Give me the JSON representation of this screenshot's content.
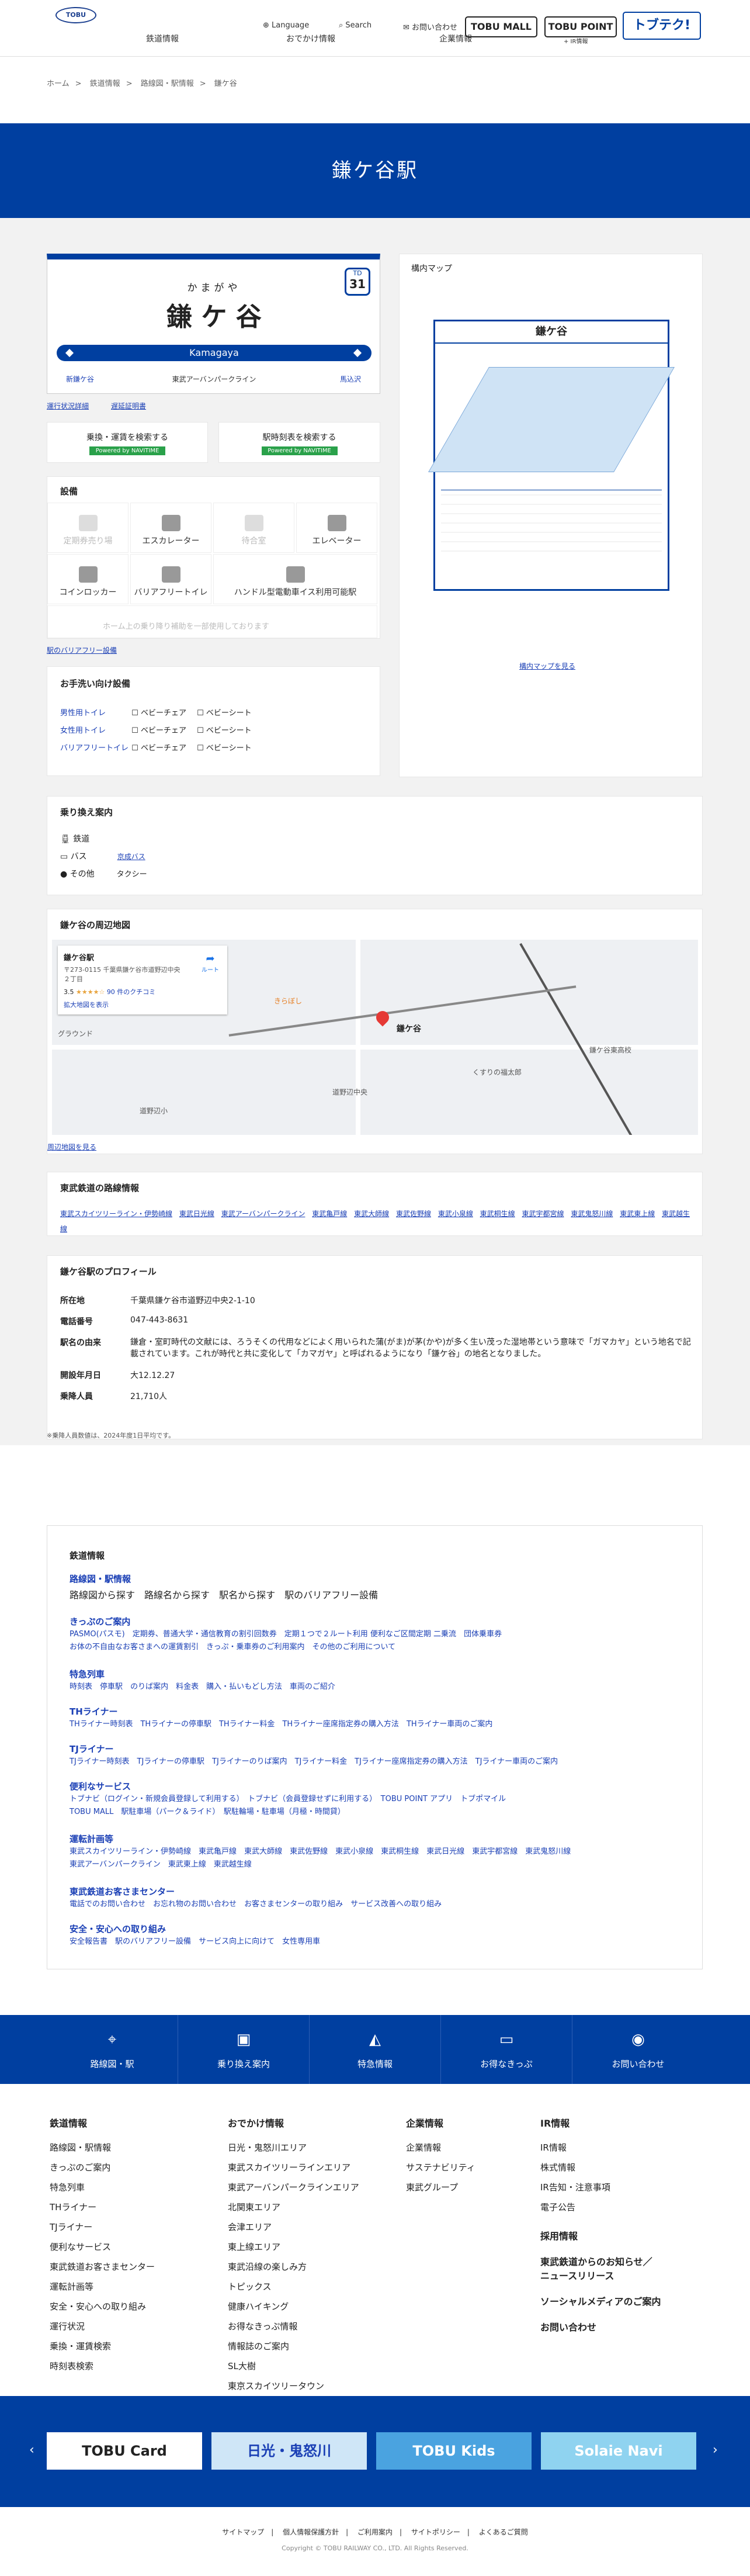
{
  "header": {
    "logo": "TOBU",
    "nav": [
      "鉄道情報",
      "おでかけ情報",
      "企業情報"
    ],
    "language": "Language",
    "search": "Search",
    "contact": "お問い合わせ",
    "btn_mall": "TOBU MALL",
    "btn_point": "TOBU POINT",
    "btn_point_sub": "+ IR情報",
    "btn_tobuteku": "トブテク!"
  },
  "breadcrumb": [
    "ホーム",
    "鉄道情報",
    "路線図・駅情報",
    "鎌ケ谷"
  ],
  "hero_title": "鎌ケ谷駅",
  "sign": {
    "kana": "かまがや",
    "name": "鎌 ケ 谷",
    "roman": "Kamagaya",
    "code_top": "TD",
    "code_num": "31",
    "prev": "新鎌ケ谷",
    "line": "東武アーバンパークライン",
    "next": "馬込沢"
  },
  "sign_links": [
    "運行状況詳細",
    "遅延証明書"
  ],
  "search_boxes": [
    {
      "label": "乗換・運賃を検索する",
      "powered": "Powered by NAVITIME"
    },
    {
      "label": "駅時刻表を検索する",
      "powered": "Powered by NAVITIME"
    }
  ],
  "facilities": {
    "title": "設備",
    "items": [
      "定期券売り場",
      "エスカレーター",
      "待合室",
      "エレベーター",
      "コインロッカー",
      "バリアフリートイレ",
      "ハンドル型電動車イス利用可能駅",
      "ホーム上の乗り降り補助を一部使用しております"
    ],
    "link": "駅のバリアフリー設備"
  },
  "toilets": {
    "title": "お手洗い向け設備",
    "rows": [
      {
        "name": "男性用トイレ",
        "items": [
          "ベビーチェア",
          "ベビーシート"
        ]
      },
      {
        "name": "女性用トイレ",
        "items": [
          "ベビーチェア",
          "ベビーシート"
        ]
      },
      {
        "name": "バリアフリートイレ",
        "items": [
          "ベビーチェア",
          "ベビーシート"
        ]
      }
    ]
  },
  "map": {
    "title": "構内マップ",
    "station": "鎌ケ谷",
    "link": "構内マップを見る"
  },
  "transfer": {
    "title": "乗り換え案内",
    "rows": [
      {
        "k": "鉄道",
        "v": ""
      },
      {
        "k": "バス",
        "v": "京成バス"
      },
      {
        "k": "その他",
        "v": "タクシー"
      }
    ]
  },
  "area_map": {
    "title": "鎌ケ谷の周辺地図",
    "place": "鎌ケ谷駅",
    "address": "〒273-0115 千葉県鎌ケ谷市道野辺中央２丁目",
    "rating": "3.5",
    "reviews": "90 件のクチコミ",
    "enlarge": "拡大地図を表示",
    "route": "ルート",
    "link": "周辺地図を見る",
    "labels": [
      "道野辺中央",
      "鎌ケ谷",
      "きらぼし",
      "くすりの福太郎",
      "鎌ケ谷東高校",
      "道野辺小",
      "グラウンド"
    ]
  },
  "lines": {
    "title": "東武鉄道の路線情報",
    "items": [
      "東武スカイツリーライン・伊勢崎線",
      "東武日光線",
      "東武アーバンパークライン",
      "東武亀戸線",
      "東武大師線",
      "東武佐野線",
      "東武小泉線",
      "東武桐生線",
      "東武宇都宮線",
      "東武鬼怒川線",
      "東武東上線",
      "東武越生線"
    ]
  },
  "profile": {
    "title": "鎌ケ谷駅のプロフィール",
    "rows": [
      {
        "k": "所在地",
        "v": "千葉県鎌ケ谷市道野辺中央2-1-10"
      },
      {
        "k": "電話番号",
        "v": "047-443-8631"
      },
      {
        "k": "駅名の由来",
        "v": "鎌倉・室町時代の文献には、ろうそくの代用などによく用いられた蒲(がま)が茅(かや)が多く生い茂った湿地帯という意味で「ガマカヤ」という地名で記載されています。これが時代と共に変化して「カマガヤ」と呼ばれるようになり「鎌ケ谷」の地名となりました。"
      },
      {
        "k": "開設年月日",
        "v": "大12.12.27"
      },
      {
        "k": "乗降人員",
        "v": "21,710人"
      }
    ],
    "note": "※乗降人員数値は、2024年度1日平均です。"
  },
  "sitemap": {
    "title": "鉄道情報",
    "groups": [
      {
        "h": "路線図・駅情報",
        "links": [
          "路線図から探す",
          "路線名から探す",
          "駅名から探す",
          "駅のバリアフリー設備"
        ]
      },
      {
        "h": "きっぷのご案内",
        "links": [
          "PASMO(パスモ)",
          "定期券、普通大学・通信教育の割引回数券",
          "定期１つで２ルート利用 便利なご区間定期 二乗流",
          "団体乗車券",
          "お体の不自由なお客さまへの運賃割引",
          "きっぷ・乗車券のご利用案内",
          "その他のご利用について"
        ]
      },
      {
        "h": "特急列車",
        "links": [
          "時刻表",
          "停車駅",
          "のりば案内",
          "料金表",
          "購入・払いもどし方法",
          "車両のご紹介"
        ]
      },
      {
        "h": "THライナー",
        "links": [
          "THライナー時刻表",
          "THライナーの停車駅",
          "THライナー料金",
          "THライナー座席指定券の購入方法",
          "THライナー車両のご案内"
        ]
      },
      {
        "h": "TJライナー",
        "links": [
          "TJライナー時刻表",
          "TJライナーの停車駅",
          "TJライナーのりば案内",
          "TJライナー料金",
          "TJライナー座席指定券の購入方法",
          "TJライナー車両のご案内"
        ]
      },
      {
        "h": "便利なサービス",
        "links": [
          "トブナビ（ログイン・新規会員登録して利用する）",
          "トブナビ（会員登録せずに利用する）",
          "TOBU POINT アプリ",
          "トブポマイル",
          "TOBU MALL",
          "駅駐車場（パーク＆ライド）",
          "駅駐輪場・駐車場（月極・時間貸）"
        ]
      },
      {
        "h": "運転計画等",
        "links": [
          "東武スカイツリーライン・伊勢崎線",
          "東武亀戸線",
          "東武大師線",
          "東武佐野線",
          "東武小泉線",
          "東武桐生線",
          "東武日光線",
          "東武宇都宮線",
          "東武鬼怒川線",
          "東武アーバンパークライン",
          "東武東上線",
          "東武越生線"
        ]
      },
      {
        "h": "東武鉄道お客さまセンター",
        "links": [
          "電話でのお問い合わせ",
          "お忘れ物のお問い合わせ",
          "お客さまセンターの取り組み",
          "サービス改善への取り組み"
        ]
      },
      {
        "h": "安全・安心への取り組み",
        "links": [
          "安全報告書",
          "駅のバリアフリー設備",
          "サービス向上に向けて",
          "女性専用車"
        ]
      }
    ]
  },
  "footnav": [
    "路線図・駅",
    "乗り換え案内",
    "特急情報",
    "お得なきっぷ",
    "お問い合わせ"
  ],
  "footer_cols": [
    {
      "title": "鉄道情報",
      "items": [
        "路線図・駅情報",
        "きっぷのご案内",
        "特急列車",
        "THライナー",
        "TJライナー",
        "便利なサービス",
        "東武鉄道お客さまセンター",
        "運転計画等",
        "安全・安心への取り組み",
        "運行状況",
        "乗換・運賃検索",
        "時刻表検索"
      ]
    },
    {
      "title": "おでかけ情報",
      "items": [
        "日光・鬼怒川エリア",
        "東武スカイツリーラインエリア",
        "東武アーバンパークラインエリア",
        "北関東エリア",
        "会津エリア",
        "東上線エリア",
        "東武沿線の楽しみ方",
        "トピックス",
        "健康ハイキング",
        "お得なきっぷ情報",
        "情報誌のご案内",
        "SL大樹",
        "東京スカイツリータウン"
      ]
    },
    {
      "title": "企業情報",
      "items": [
        "企業情報",
        "サステナビリティ",
        "東武グループ"
      ]
    },
    {
      "title": "IR情報",
      "items": [
        "IR情報",
        "株式情報",
        "IR告知・注意事項",
        "電子公告"
      ]
    }
  ],
  "footer_right": [
    "採用情報",
    "東武鉄道からのお知らせ／ニュースリリース",
    "ソーシャルメディアのご案内",
    "お問い合わせ"
  ],
  "banners": [
    "TOBU Card",
    "日光・鬼怒川",
    "TOBU Kids",
    "Solaie Navi"
  ],
  "bottom_links": [
    "サイトマップ",
    "個人情報保護方針",
    "ご利用案内",
    "サイトポリシー",
    "よくあるご質問"
  ],
  "copyright": "Copyright © TOBU RAILWAY CO., LTD. All Rights Reserved.",
  "colors": {
    "primary": "#003fa0",
    "link": "#1a3fb5",
    "background": "#f2f2f2",
    "navitime": "#2aa14a"
  }
}
